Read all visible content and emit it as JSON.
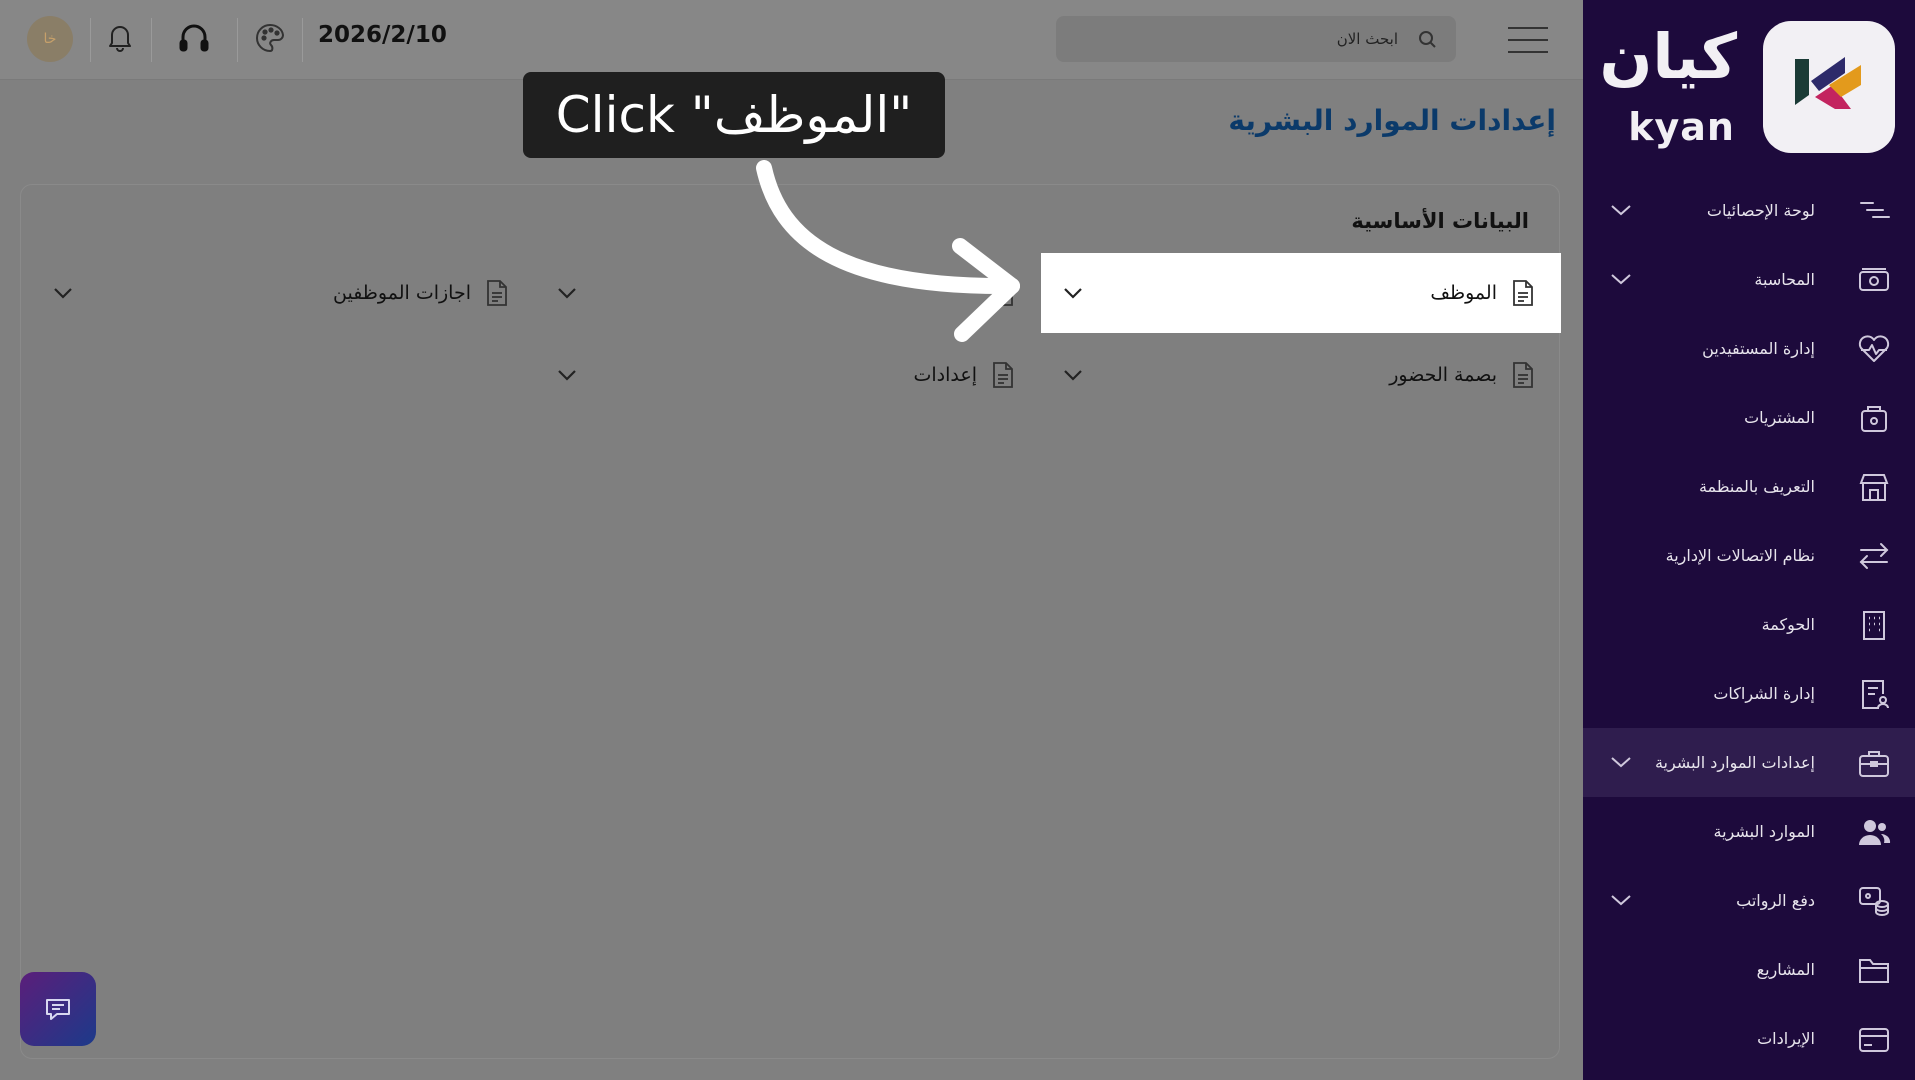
{
  "brand": {
    "name_ar": "كيان",
    "name_en": "kyan"
  },
  "sidebar": {
    "items": [
      {
        "label": "لوحة الإحصائيات",
        "icon": "stats-icon",
        "has_chevron": true
      },
      {
        "label": "المحاسبة",
        "icon": "cash-icon",
        "has_chevron": true
      },
      {
        "label": "إدارة المستفيدين",
        "icon": "heart-pulse-icon",
        "has_chevron": false
      },
      {
        "label": "المشتريات",
        "icon": "bag-icon",
        "has_chevron": false
      },
      {
        "label": "التعريف بالمنظمة",
        "icon": "store-icon",
        "has_chevron": false
      },
      {
        "label": "نظام الاتصالات الإدارية",
        "icon": "arrows-exchange-icon",
        "has_chevron": false
      },
      {
        "label": "الحوكمة",
        "icon": "building-icon",
        "has_chevron": false
      },
      {
        "label": "إدارة الشراكات",
        "icon": "document-user-icon",
        "has_chevron": false
      },
      {
        "label": "إعدادات الموارد البشرية",
        "icon": "briefcase-icon",
        "has_chevron": true,
        "active": true
      },
      {
        "label": "الموارد البشرية",
        "icon": "users-icon",
        "has_chevron": false
      },
      {
        "label": "دفع الرواتب",
        "icon": "coins-icon",
        "has_chevron": true
      },
      {
        "label": "المشاريع",
        "icon": "folder-icon",
        "has_chevron": false
      },
      {
        "label": "الإيرادات",
        "icon": "card-icon",
        "has_chevron": false
      }
    ]
  },
  "topbar": {
    "search_placeholder": "ابحث الان",
    "date": "2026/2/10",
    "avatar_initials": "خا"
  },
  "main": {
    "page_title": "إعدادات الموارد البشرية",
    "section_title": "البيانات الأساسية",
    "items": [
      {
        "label": "الموظف",
        "highlighted": true
      },
      {
        "label": ""
      },
      {
        "label": "اجازات الموظفين"
      },
      {
        "label": "بصمة الحضور"
      },
      {
        "label": "إعدادات"
      }
    ]
  },
  "annotation": {
    "text": "Click \"الموظف\""
  },
  "colors": {
    "sidebar_bg": "#1d0a3c",
    "sidebar_active": "#2f1d4e",
    "title_blue": "#0b3a6a",
    "overlay": "#808080"
  }
}
